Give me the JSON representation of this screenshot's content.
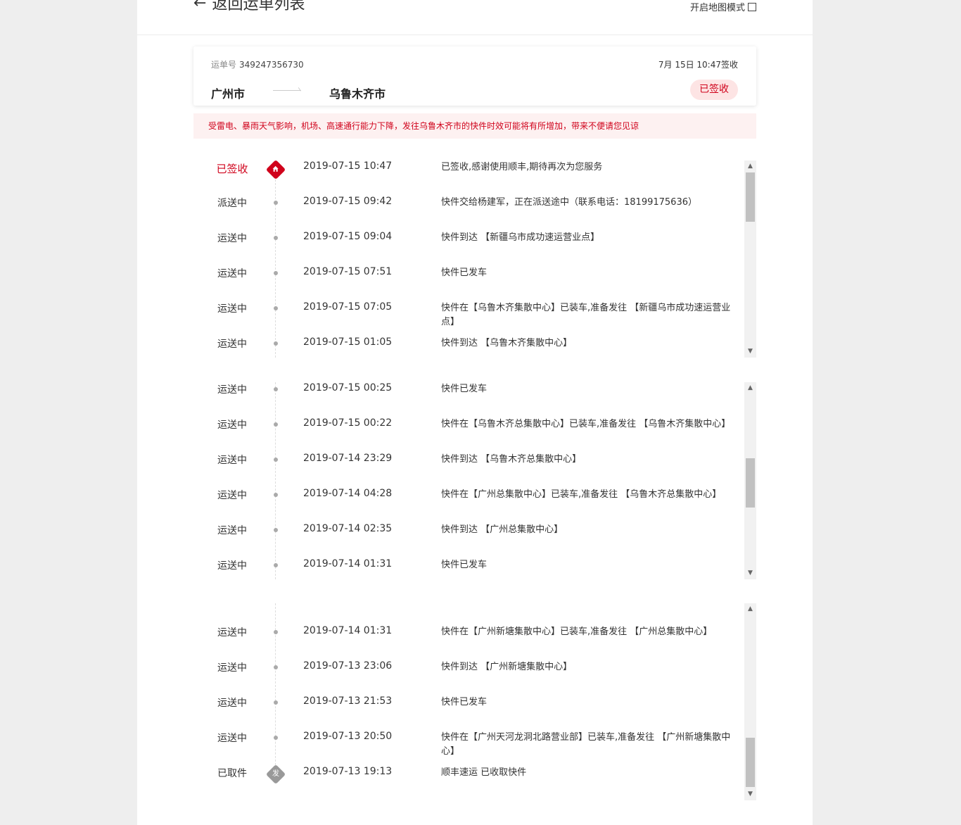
{
  "header": {
    "back_label": "返回运单列表",
    "map_mode_label": "开启地图模式"
  },
  "waybill": {
    "number_label": "运单号",
    "number": "349247356730",
    "signed_time": "7月 15日 10:47签收",
    "from": "广州市",
    "to": "乌鲁木齐市",
    "status_badge": "已签收"
  },
  "notice": "受雷电、暴雨天气影响，机场、高速通行能力下降，发往乌鲁木齐市的快件时效可能将有所增加，带来不便请您见谅",
  "groups": [
    {
      "events": [
        {
          "status": "已签收",
          "time": "2019-07-15 10:47",
          "desc": "已签收,感谢使用顺丰,期待再次为您服务"
        },
        {
          "status": "派送中",
          "time": "2019-07-15 09:42",
          "desc": "快件交给杨建军，正在派送途中（联系电话：18199175636）"
        },
        {
          "status": "运送中",
          "time": "2019-07-15 09:04",
          "desc": "快件到达 【新疆乌市成功速运营业点】"
        },
        {
          "status": "运送中",
          "time": "2019-07-15 07:51",
          "desc": "快件已发车"
        },
        {
          "status": "运送中",
          "time": "2019-07-15 07:05",
          "desc": "快件在【乌鲁木齐集散中心】已装车,准备发往 【新疆乌市成功速运营业点】"
        },
        {
          "status": "运送中",
          "time": "2019-07-15 01:05",
          "desc": "快件到达 【乌鲁木齐集散中心】"
        }
      ]
    },
    {
      "events": [
        {
          "status": "运送中",
          "time": "2019-07-15 00:25",
          "desc": "快件已发车"
        },
        {
          "status": "运送中",
          "time": "2019-07-15 00:22",
          "desc": "快件在【乌鲁木齐总集散中心】已装车,准备发往 【乌鲁木齐集散中心】"
        },
        {
          "status": "运送中",
          "time": "2019-07-14 23:29",
          "desc": "快件到达 【乌鲁木齐总集散中心】"
        },
        {
          "status": "运送中",
          "time": "2019-07-14 04:28",
          "desc": "快件在【广州总集散中心】已装车,准备发往 【乌鲁木齐总集散中心】"
        },
        {
          "status": "运送中",
          "time": "2019-07-14 02:35",
          "desc": "快件到达 【广州总集散中心】"
        },
        {
          "status": "运送中",
          "time": "2019-07-14 01:31",
          "desc": "快件已发车"
        }
      ]
    },
    {
      "events": [
        {
          "status": "运送中",
          "time": "2019-07-14 01:31",
          "desc": "快件在【广州新塘集散中心】已装车,准备发往 【广州总集散中心】"
        },
        {
          "status": "运送中",
          "time": "2019-07-13 23:06",
          "desc": "快件到达 【广州新塘集散中心】"
        },
        {
          "status": "运送中",
          "time": "2019-07-13 21:53",
          "desc": "快件已发车"
        },
        {
          "status": "运送中",
          "time": "2019-07-13 20:50",
          "desc": "快件在【广州天河龙洞北路营业部】已装车,准备发往 【广州新塘集散中心】"
        },
        {
          "status": "已取件",
          "time": "2019-07-13 19:13",
          "desc": "顺丰速运 已收取快件"
        }
      ]
    }
  ],
  "icons": {
    "signed_marker": "home-icon",
    "pickup_marker_text": "发"
  },
  "colors": {
    "accent": "#d0021b",
    "badge_bg": "#fde4e4",
    "notice_bg": "#fdf1f1"
  }
}
